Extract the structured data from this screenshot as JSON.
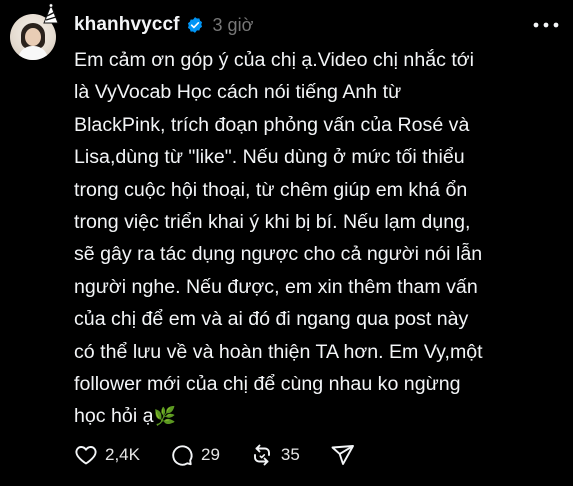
{
  "post": {
    "username": "khanhvyccf",
    "time": "3 giờ",
    "lines": [
      "Em cảm ơn góp ý của chị ạ.Video chị nhắc tới",
      "là VyVocab Học cách nói tiếng Anh từ",
      "BlackPink, trích đoạn phỏng vấn của Rosé và",
      "Lisa,dùng từ \"like\". Nếu dùng ở mức tối thiểu",
      "trong cuộc hội thoại, từ chêm giúp em khá ổn",
      "trong việc triển khai ý khi bị bí. Nếu lạm dụng,",
      "sẽ gây ra tác dụng ngược cho cả người nói lẫn",
      "người nghe. Nếu được, em xin thêm tham vấn",
      "của chị để em và ai đó đi ngang qua post này",
      "có thể lưu về và hoàn thiện TA hơn. Em Vy,một",
      "follower mới của chị để cùng nhau ko ngừng"
    ],
    "last_line": "học hỏi ạ",
    "emoji": "🌿"
  },
  "actions": {
    "likes": "2,4K",
    "comments": "29",
    "reposts": "35"
  },
  "icons": {
    "avatar": "avatar-icon",
    "party_hat": "party-hat-icon",
    "verified": "verified-badge-icon",
    "more": "more-options-icon",
    "like": "heart-icon",
    "comment": "comment-icon",
    "repost": "repost-icon",
    "share": "share-icon"
  },
  "colors": {
    "background": "#000000",
    "text": "#f3f5f7",
    "muted": "#777777",
    "verified": "#0095f6"
  }
}
